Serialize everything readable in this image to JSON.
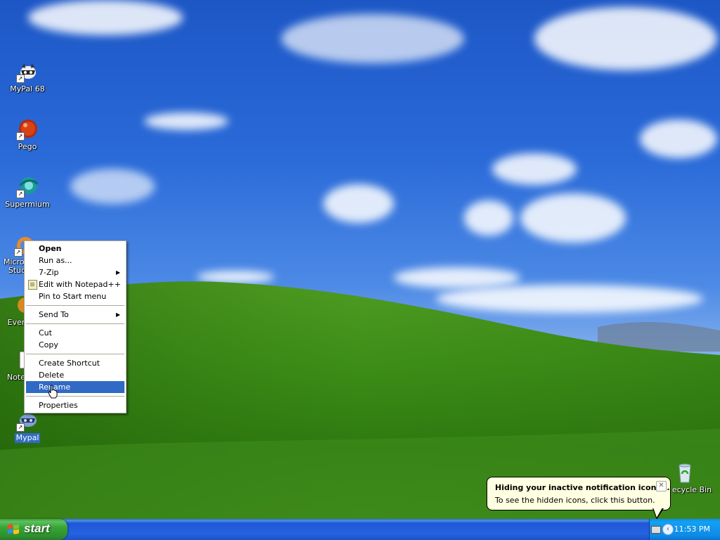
{
  "desktop": {
    "icons": [
      {
        "label": "MyPal 68"
      },
      {
        "label": "Pego"
      },
      {
        "label": "Supermium"
      },
      {
        "label": "Microso Studi"
      },
      {
        "label": "Ever"
      },
      {
        "label": "Note"
      },
      {
        "label": "Mypal"
      }
    ],
    "recycle_bin": {
      "label": "ecycle Bin"
    }
  },
  "context_menu": {
    "items": {
      "open": "Open",
      "run_as": "Run as...",
      "seven_zip": "7-Zip",
      "edit_notepad": "Edit with Notepad++",
      "pin_start": "Pin to Start menu",
      "send_to": "Send To",
      "cut": "Cut",
      "copy": "Copy",
      "create_shortcut": "Create Shortcut",
      "delete": "Delete",
      "rename": "Rename",
      "properties": "Properties"
    },
    "highlighted": "Rename"
  },
  "balloon": {
    "title": "Hiding your inactive notification icons...",
    "body": "To see the hidden icons, click this button.",
    "close_glyph": "✕"
  },
  "taskbar": {
    "start_label": "start",
    "clock": "11:53 PM",
    "chevron_glyph": "‹"
  },
  "colors": {
    "selection": "#316ac5",
    "taskbar": "#2457d6",
    "start_button": "#3aa53a",
    "balloon": "#ffffe1"
  }
}
